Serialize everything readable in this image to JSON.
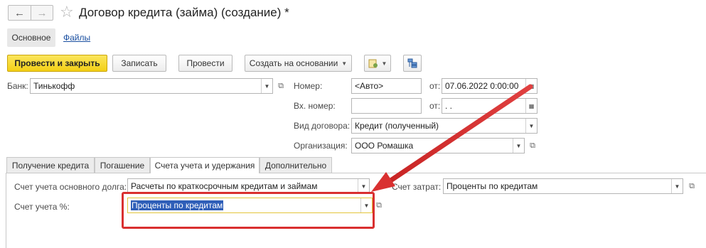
{
  "window": {
    "title": "Договор кредита (займа) (создание) *"
  },
  "sections": {
    "main": "Основное",
    "files": "Файлы"
  },
  "toolbar": {
    "post_close": "Провести и закрыть",
    "save": "Записать",
    "post": "Провести",
    "create_based": "Создать на основании"
  },
  "header": {
    "bank_label": "Банк:",
    "bank_value": "Тинькофф",
    "number_label": "Номер:",
    "number_placeholder": "<Авто>",
    "from_label": "от:",
    "date_value": "07.06.2022  0:00:00",
    "in_number_label": "Вх. номер:",
    "from2_label": "от:",
    "date2_value": " .  .",
    "contract_type_label": "Вид договора:",
    "contract_type_value": "Кредит (полученный)",
    "org_label": "Организация:",
    "org_value": "ООО Ромашка"
  },
  "tabs": [
    {
      "label": "Получение кредита"
    },
    {
      "label": "Погашение"
    },
    {
      "label": "Счета учета и удержания"
    },
    {
      "label": "Дополнительно"
    }
  ],
  "accounts": {
    "main_debt_label": "Счет учета основного долга:",
    "main_debt_value": "Расчеты по краткосрочным кредитам и займам",
    "expense_label": "Счет затрат:",
    "expense_value": "Проценты по кредитам",
    "percent_label": "Счет учета %:",
    "percent_value": "Проценты по кредитам"
  },
  "colors": {
    "accent": "#f3cf15",
    "highlight": "#d93030",
    "selection": "#2e5eb8"
  }
}
